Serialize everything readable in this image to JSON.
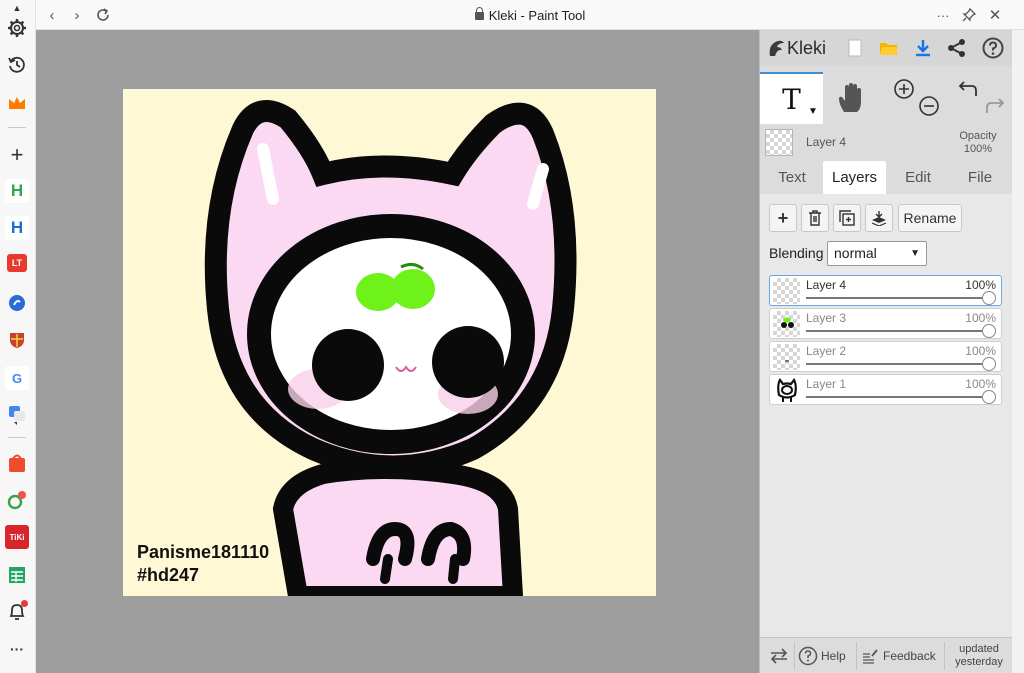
{
  "window": {
    "title": "Kleki - Paint Tool",
    "more_label": "···"
  },
  "sidebar": {
    "icons": [
      "gear-icon",
      "history-icon",
      "crown-icon",
      "plus-icon",
      "app-h-icon",
      "app-h2-icon",
      "app-lt-icon",
      "app-blue-icon",
      "app-shield-icon",
      "google-icon",
      "translate-icon",
      "shopee-icon",
      "web-tool-icon",
      "tiki-icon",
      "sheets-icon",
      "bell-icon",
      "more-icon"
    ],
    "lt_text": "LT",
    "g_text": "G",
    "tiki_text": "TiKi",
    "more_text": "···"
  },
  "canvas": {
    "caption_line1": "Panisme181110",
    "caption_line2": "#hd247",
    "background": "#fff8d4"
  },
  "panel": {
    "logo": "Kleki",
    "header_icons": [
      "new-image-icon",
      "open-folder-icon",
      "download-icon",
      "share-icon",
      "help-icon"
    ],
    "tools": {
      "text_tool": "T",
      "tools_icons": [
        "hand-icon",
        "zoom-in-icon",
        "zoom-out-icon",
        "undo-icon",
        "redo-icon"
      ]
    },
    "active_layer": {
      "name": "Layer 4",
      "opacity_label": "Opacity",
      "opacity_value": "100%"
    },
    "tabs": [
      {
        "label": "Text"
      },
      {
        "label": "Layers"
      },
      {
        "label": "Edit"
      },
      {
        "label": "File"
      }
    ],
    "active_tab": "Layers",
    "layer_buttons": {
      "add": "+",
      "rename": "Rename"
    },
    "blending": {
      "label": "Blending",
      "value": "normal"
    },
    "layers": [
      {
        "name": "Layer 4",
        "opacity": "100%",
        "level": 1.0
      },
      {
        "name": "Layer 3",
        "opacity": "100%",
        "level": 1.0
      },
      {
        "name": "Layer 2",
        "opacity": "100%",
        "level": 1.0
      },
      {
        "name": "Layer 1",
        "opacity": "100%",
        "level": 1.0
      }
    ],
    "footer": {
      "help": "Help",
      "feedback": "Feedback",
      "updated_line1": "updated",
      "updated_line2": "yesterday"
    }
  },
  "colors": {
    "accent": "#3f8edc",
    "pink": "#fbd9f2",
    "sprout": "#6ef21a",
    "ink": "#0a0a0a"
  }
}
